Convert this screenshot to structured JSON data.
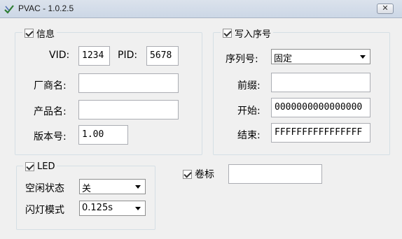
{
  "window": {
    "title": "PVAC - 1.0.2.5",
    "close_label": "✕"
  },
  "info_group": {
    "legend": "信息",
    "checked": true,
    "vid_label": "VID:",
    "vid_value": "1234",
    "pid_label": "PID:",
    "pid_value": "5678",
    "manufacturer_label": "厂商名:",
    "manufacturer_value": "",
    "product_label": "产品名:",
    "product_value": "",
    "version_label": "版本号:",
    "version_value": "1.00"
  },
  "serial_group": {
    "legend": "写入序号",
    "checked": true,
    "serial_label": "序列号:",
    "serial_mode": "固定",
    "prefix_label": "前缀:",
    "prefix_value": "",
    "start_label": "开始:",
    "start_value": "0000000000000000",
    "end_label": "结束:",
    "end_value": "FFFFFFFFFFFFFFFF"
  },
  "led_group": {
    "legend": "LED",
    "checked": true,
    "idle_label": "空闲状态",
    "idle_value": "关",
    "blink_label": "闪灯模式",
    "blink_value": "0.125s"
  },
  "volume": {
    "label": "卷标",
    "checked": true,
    "value": ""
  }
}
